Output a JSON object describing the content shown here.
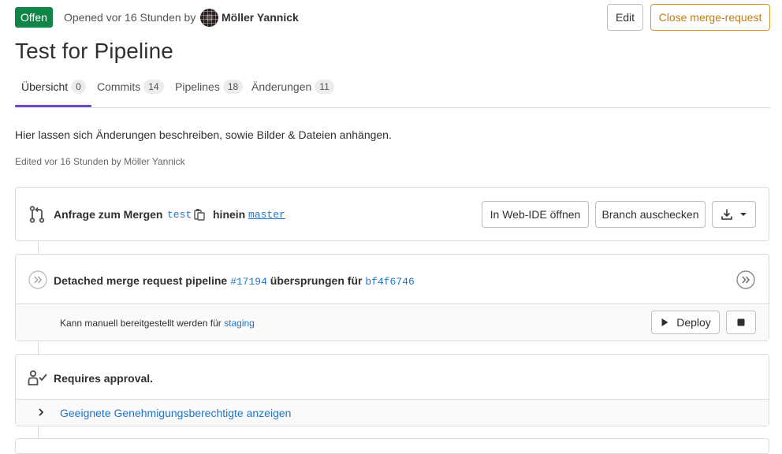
{
  "header": {
    "status_badge": "Offen",
    "opened_text": "Opened vor 16 Stunden by",
    "author": "Möller Yannick",
    "edit_label": "Edit",
    "close_label": "Close merge-request"
  },
  "title": "Test for Pipeline",
  "tabs": [
    {
      "label": "Übersicht",
      "count": "0"
    },
    {
      "label": "Commits",
      "count": "14"
    },
    {
      "label": "Pipelines",
      "count": "18"
    },
    {
      "label": "Änderungen",
      "count": "11"
    }
  ],
  "description": "Hier lassen sich Änderungen beschreiben, sowie Bilder & Dateien anhängen.",
  "edited_text": "Edited vor 16 Stunden by Möller Yannick",
  "merge": {
    "label": "Anfrage zum Mergen",
    "source_branch": "test",
    "into": "hinein",
    "target_branch": "master",
    "webide_label": "In Web-IDE öffnen",
    "checkout_label": "Branch auschecken"
  },
  "pipeline": {
    "prefix": "Detached merge request pipeline",
    "id": "#17194",
    "middle": "übersprungen für",
    "commit": "bf4f6746",
    "manual_text": "Kann manuell bereitgestellt werden für",
    "environment": "staging",
    "deploy_label": "Deploy"
  },
  "approval": {
    "title": "Requires approval.",
    "link": "Geeignete Genehmigungsberechtigte anzeigen"
  },
  "colors": {
    "open_badge": "#108548",
    "close_border": "#d99530",
    "link": "#1f75cb",
    "tab_underline": "#6e49cb"
  },
  "icons": {
    "merge": "git-merge-request-icon",
    "copy": "copy-icon",
    "download": "download-icon",
    "skipped": "status-skipped-icon",
    "play": "play-icon",
    "stop": "stop-icon",
    "approval": "approval-user-icon",
    "chevron": "chevron-right-icon"
  }
}
